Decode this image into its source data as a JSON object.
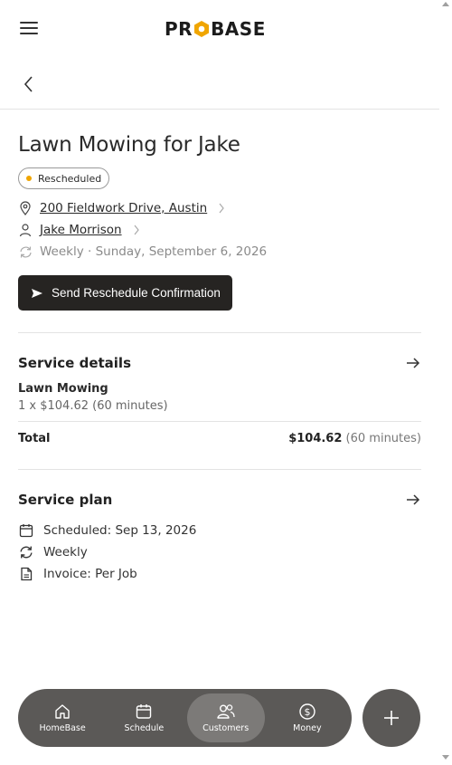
{
  "app": {
    "logo_text_left": "PR",
    "logo_text_right": "BASE",
    "brand_color": "#f0a500"
  },
  "header": {
    "menu_icon": "hamburger-menu-icon",
    "back_icon": "chevron-left-icon"
  },
  "job": {
    "title": "Lawn Mowing for Jake",
    "status": "Rescheduled",
    "status_color": "#f0a500",
    "address": "200 Fieldwork Drive, Austin",
    "customer": "Jake Morrison",
    "recurrence": "Weekly · Sunday, September 6, 2026",
    "action_label": "Send Reschedule Confirmation"
  },
  "service_details": {
    "heading": "Service details",
    "item_name": "Lawn Mowing",
    "item_detail": "1 x $104.62 (60 minutes)",
    "total_label": "Total",
    "total_amount": "$104.62",
    "total_duration": "(60 minutes)"
  },
  "service_plan": {
    "heading": "Service plan",
    "rows": [
      {
        "icon": "calendar-icon",
        "text": "Scheduled: Sep 13, 2026"
      },
      {
        "icon": "repeat-icon",
        "text": "Weekly"
      },
      {
        "icon": "document-icon",
        "text": "Invoice: Per Job"
      }
    ]
  },
  "bottom_nav": {
    "items": [
      {
        "label": "HomeBase",
        "icon": "home-icon"
      },
      {
        "label": "Schedule",
        "icon": "calendar-icon"
      },
      {
        "label": "Customers",
        "icon": "users-icon",
        "active": true
      },
      {
        "label": "Money",
        "icon": "dollar-icon"
      }
    ],
    "fab_icon": "plus-icon"
  }
}
